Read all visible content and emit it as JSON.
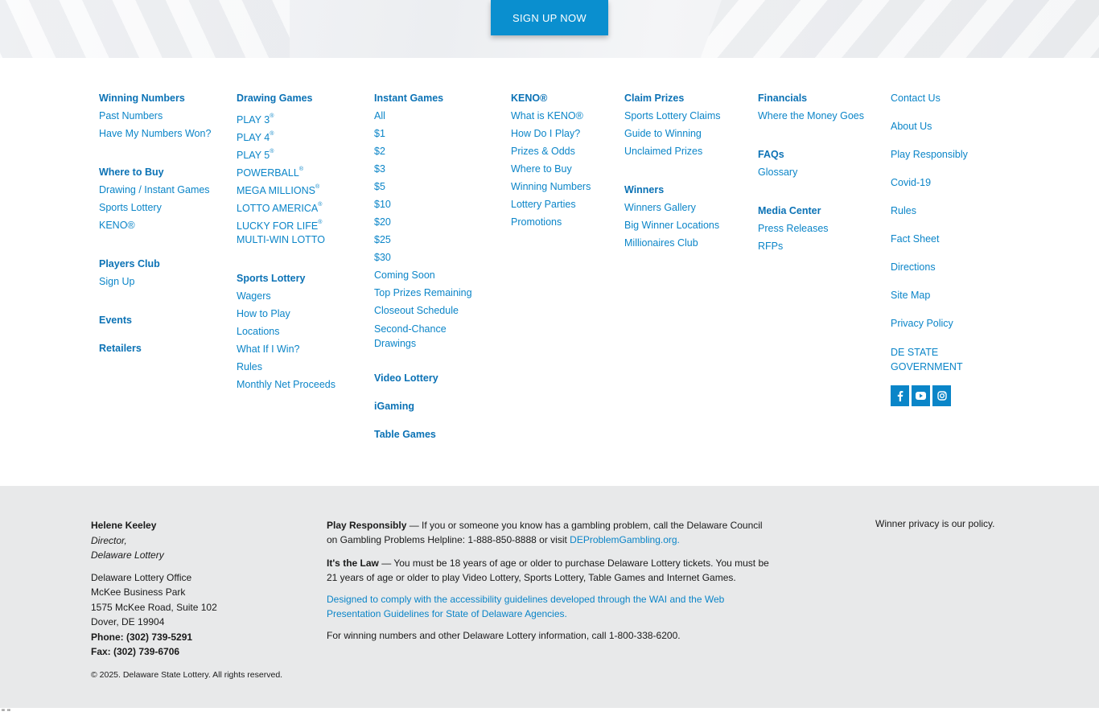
{
  "hero": {
    "signup_label": "SIGN UP NOW"
  },
  "nav": {
    "col1": {
      "winning_numbers": "Winning Numbers",
      "past_numbers": "Past Numbers",
      "have_my_numbers_won": "Have My Numbers Won?",
      "where_to_buy": "Where to Buy",
      "drawing_instant": "Drawing / Instant Games",
      "sports_lottery": "Sports Lottery",
      "keno": "KENO®",
      "players_club": "Players Club",
      "sign_up": "Sign Up",
      "events": "Events",
      "retailers": "Retailers"
    },
    "col2": {
      "drawing_games": "Drawing Games",
      "play3": "PLAY 3",
      "play4": "PLAY 4",
      "play5": "PLAY 5",
      "powerball": "POWERBALL",
      "mega_millions": "MEGA MILLIONS",
      "lotto_america": "LOTTO AMERICA",
      "lucky_for_life": "LUCKY FOR LIFE",
      "multi_win": "MULTI-WIN LOTTO",
      "reg": "®",
      "sports_lottery": "Sports Lottery",
      "wagers": "Wagers",
      "how_to_play": "How to Play",
      "locations": "Locations",
      "what_if": "What If I Win?",
      "rules": "Rules",
      "monthly": "Monthly Net Proceeds"
    },
    "col3": {
      "instant_games": "Instant Games",
      "prices": [
        "All",
        "$1",
        "$2",
        "$3",
        "$5",
        "$10",
        "$20",
        "$25",
        "$30"
      ],
      "coming_soon": "Coming Soon",
      "top_prizes": "Top Prizes Remaining",
      "closeout": "Closeout Schedule",
      "second_chance": "Second-Chance Drawings",
      "video_lottery": "Video Lottery",
      "igaming": "iGaming",
      "table_games": "Table Games"
    },
    "col4": {
      "keno": "KENO®",
      "what_is_keno": "What is KENO®",
      "how_do_i_play": "How Do I Play?",
      "prizes_odds": "Prizes & Odds",
      "where_to_buy": "Where to Buy",
      "winning_numbers": "Winning Numbers",
      "lottery_parties": "Lottery Parties",
      "promotions": "Promotions"
    },
    "col5": {
      "claim_prizes": "Claim Prizes",
      "sports_claims": "Sports Lottery Claims",
      "guide": "Guide to Winning",
      "unclaimed": "Unclaimed Prizes",
      "winners": "Winners",
      "winners_gallery": "Winners Gallery",
      "big_winner": "Big Winner Locations",
      "millionaires": "Millionaires Club"
    },
    "col6": {
      "financials": "Financials",
      "money_goes": "Where the Money Goes",
      "faqs": "FAQs",
      "glossary": "Glossary",
      "media_center": "Media Center",
      "press": "Press Releases",
      "rfps": "RFPs"
    },
    "col7": {
      "contact": "Contact Us",
      "about": "About Us",
      "play_responsibly": "Play Responsibly",
      "covid": "Covid-19",
      "rules": "Rules",
      "fact_sheet": "Fact Sheet",
      "directions": "Directions",
      "site_map": "Site Map",
      "privacy": "Privacy Policy",
      "de_gov": "DE STATE GOVERNMENT",
      "social_icons": [
        "facebook-icon",
        "youtube-icon",
        "instagram-icon"
      ]
    }
  },
  "footer": {
    "name": "Helene Keeley",
    "title": "Director,",
    "org": "Delaware Lottery",
    "office": "Delaware Lottery Office",
    "park": "McKee Business Park",
    "street": "1575 McKee Road, Suite 102",
    "city": "Dover, DE 19904",
    "phone": "Phone: (302) 739-5291",
    "fax": "Fax: (302) 739-6706",
    "copyright": "© 2025. Delaware State Lottery. All rights reserved.",
    "play_resp_label": "Play Responsibly",
    "play_resp_text": " — If you or someone you know has a gambling problem, call the Delaware Council on Gambling Problems Helpline: 1-888-850-8888 or visit ",
    "play_resp_link": "DEProblemGambling.org.",
    "law_label": "It's the Law",
    "law_text": " — You must be 18 years of age or older to purchase Delaware Lottery tickets. You must be 21 years of age or older to play Video Lottery, Sports Lottery, Table Games and Internet Games.",
    "accessibility": "Designed to comply with the accessibility guidelines developed through the WAI and the Web Presentation Guidelines for State of Delaware Agencies.",
    "info": "For winning numbers and other Delaware Lottery information, call 1-800-338-6200.",
    "privacy_note": "Winner privacy is our policy."
  },
  "stray": "\" \""
}
